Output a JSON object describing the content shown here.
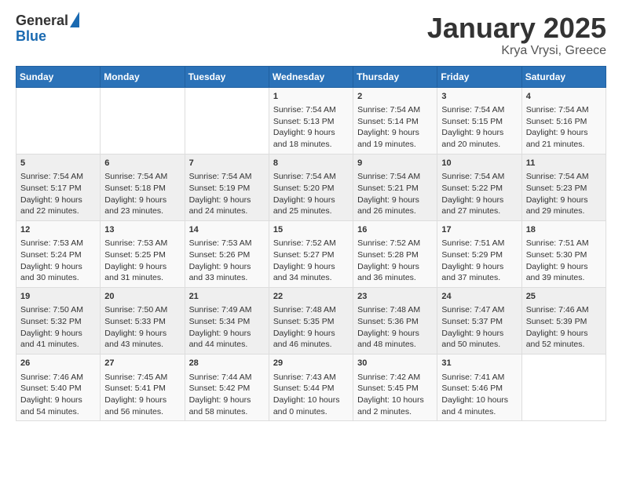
{
  "header": {
    "logo_general": "General",
    "logo_blue": "Blue",
    "title": "January 2025",
    "subtitle": "Krya Vrysi, Greece"
  },
  "calendar": {
    "days_of_week": [
      "Sunday",
      "Monday",
      "Tuesday",
      "Wednesday",
      "Thursday",
      "Friday",
      "Saturday"
    ],
    "weeks": [
      [
        {
          "day": "",
          "content": ""
        },
        {
          "day": "",
          "content": ""
        },
        {
          "day": "",
          "content": ""
        },
        {
          "day": "1",
          "content": "Sunrise: 7:54 AM\nSunset: 5:13 PM\nDaylight: 9 hours\nand 18 minutes."
        },
        {
          "day": "2",
          "content": "Sunrise: 7:54 AM\nSunset: 5:14 PM\nDaylight: 9 hours\nand 19 minutes."
        },
        {
          "day": "3",
          "content": "Sunrise: 7:54 AM\nSunset: 5:15 PM\nDaylight: 9 hours\nand 20 minutes."
        },
        {
          "day": "4",
          "content": "Sunrise: 7:54 AM\nSunset: 5:16 PM\nDaylight: 9 hours\nand 21 minutes."
        }
      ],
      [
        {
          "day": "5",
          "content": "Sunrise: 7:54 AM\nSunset: 5:17 PM\nDaylight: 9 hours\nand 22 minutes."
        },
        {
          "day": "6",
          "content": "Sunrise: 7:54 AM\nSunset: 5:18 PM\nDaylight: 9 hours\nand 23 minutes."
        },
        {
          "day": "7",
          "content": "Sunrise: 7:54 AM\nSunset: 5:19 PM\nDaylight: 9 hours\nand 24 minutes."
        },
        {
          "day": "8",
          "content": "Sunrise: 7:54 AM\nSunset: 5:20 PM\nDaylight: 9 hours\nand 25 minutes."
        },
        {
          "day": "9",
          "content": "Sunrise: 7:54 AM\nSunset: 5:21 PM\nDaylight: 9 hours\nand 26 minutes."
        },
        {
          "day": "10",
          "content": "Sunrise: 7:54 AM\nSunset: 5:22 PM\nDaylight: 9 hours\nand 27 minutes."
        },
        {
          "day": "11",
          "content": "Sunrise: 7:54 AM\nSunset: 5:23 PM\nDaylight: 9 hours\nand 29 minutes."
        }
      ],
      [
        {
          "day": "12",
          "content": "Sunrise: 7:53 AM\nSunset: 5:24 PM\nDaylight: 9 hours\nand 30 minutes."
        },
        {
          "day": "13",
          "content": "Sunrise: 7:53 AM\nSunset: 5:25 PM\nDaylight: 9 hours\nand 31 minutes."
        },
        {
          "day": "14",
          "content": "Sunrise: 7:53 AM\nSunset: 5:26 PM\nDaylight: 9 hours\nand 33 minutes."
        },
        {
          "day": "15",
          "content": "Sunrise: 7:52 AM\nSunset: 5:27 PM\nDaylight: 9 hours\nand 34 minutes."
        },
        {
          "day": "16",
          "content": "Sunrise: 7:52 AM\nSunset: 5:28 PM\nDaylight: 9 hours\nand 36 minutes."
        },
        {
          "day": "17",
          "content": "Sunrise: 7:51 AM\nSunset: 5:29 PM\nDaylight: 9 hours\nand 37 minutes."
        },
        {
          "day": "18",
          "content": "Sunrise: 7:51 AM\nSunset: 5:30 PM\nDaylight: 9 hours\nand 39 minutes."
        }
      ],
      [
        {
          "day": "19",
          "content": "Sunrise: 7:50 AM\nSunset: 5:32 PM\nDaylight: 9 hours\nand 41 minutes."
        },
        {
          "day": "20",
          "content": "Sunrise: 7:50 AM\nSunset: 5:33 PM\nDaylight: 9 hours\nand 43 minutes."
        },
        {
          "day": "21",
          "content": "Sunrise: 7:49 AM\nSunset: 5:34 PM\nDaylight: 9 hours\nand 44 minutes."
        },
        {
          "day": "22",
          "content": "Sunrise: 7:48 AM\nSunset: 5:35 PM\nDaylight: 9 hours\nand 46 minutes."
        },
        {
          "day": "23",
          "content": "Sunrise: 7:48 AM\nSunset: 5:36 PM\nDaylight: 9 hours\nand 48 minutes."
        },
        {
          "day": "24",
          "content": "Sunrise: 7:47 AM\nSunset: 5:37 PM\nDaylight: 9 hours\nand 50 minutes."
        },
        {
          "day": "25",
          "content": "Sunrise: 7:46 AM\nSunset: 5:39 PM\nDaylight: 9 hours\nand 52 minutes."
        }
      ],
      [
        {
          "day": "26",
          "content": "Sunrise: 7:46 AM\nSunset: 5:40 PM\nDaylight: 9 hours\nand 54 minutes."
        },
        {
          "day": "27",
          "content": "Sunrise: 7:45 AM\nSunset: 5:41 PM\nDaylight: 9 hours\nand 56 minutes."
        },
        {
          "day": "28",
          "content": "Sunrise: 7:44 AM\nSunset: 5:42 PM\nDaylight: 9 hours\nand 58 minutes."
        },
        {
          "day": "29",
          "content": "Sunrise: 7:43 AM\nSunset: 5:44 PM\nDaylight: 10 hours\nand 0 minutes."
        },
        {
          "day": "30",
          "content": "Sunrise: 7:42 AM\nSunset: 5:45 PM\nDaylight: 10 hours\nand 2 minutes."
        },
        {
          "day": "31",
          "content": "Sunrise: 7:41 AM\nSunset: 5:46 PM\nDaylight: 10 hours\nand 4 minutes."
        },
        {
          "day": "",
          "content": ""
        }
      ]
    ]
  }
}
